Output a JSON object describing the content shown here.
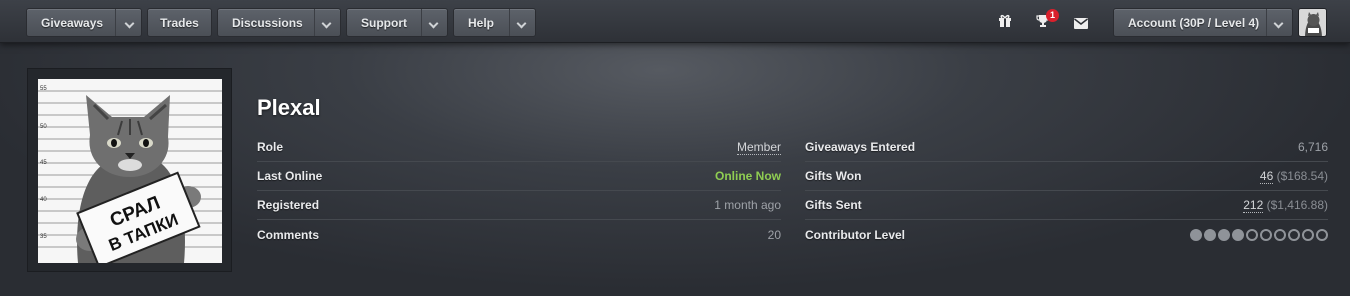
{
  "nav": {
    "giveaways_label": "Giveaways",
    "trades_label": "Trades",
    "discussions_label": "Discussions",
    "support_label": "Support",
    "help_label": "Help",
    "notification_count": "1",
    "account_label": "Account (30P / Level 4)",
    "icons": [
      "gift-icon",
      "trophy-icon",
      "mail-icon"
    ]
  },
  "profile": {
    "username": "Plexal",
    "avatar_caption_line1": "СРАЛ",
    "avatar_caption_line2": "В ТАПКИ",
    "left": {
      "role_label": "Role",
      "role_value": "Member",
      "last_online_label": "Last Online",
      "last_online_value": "Online Now",
      "registered_label": "Registered",
      "registered_value": "1 month ago",
      "comments_label": "Comments",
      "comments_value": "20"
    },
    "right": {
      "entered_label": "Giveaways Entered",
      "entered_value": "6,716",
      "won_label": "Gifts Won",
      "won_count": "46",
      "won_value": "($168.54)",
      "sent_label": "Gifts Sent",
      "sent_count": "212",
      "sent_value": "($1,416.88)",
      "contributor_label": "Contributor Level",
      "contributor_level": 4,
      "contributor_max": 10
    }
  },
  "colors": {
    "online": "#8fcd52",
    "badge": "#d9202c"
  }
}
